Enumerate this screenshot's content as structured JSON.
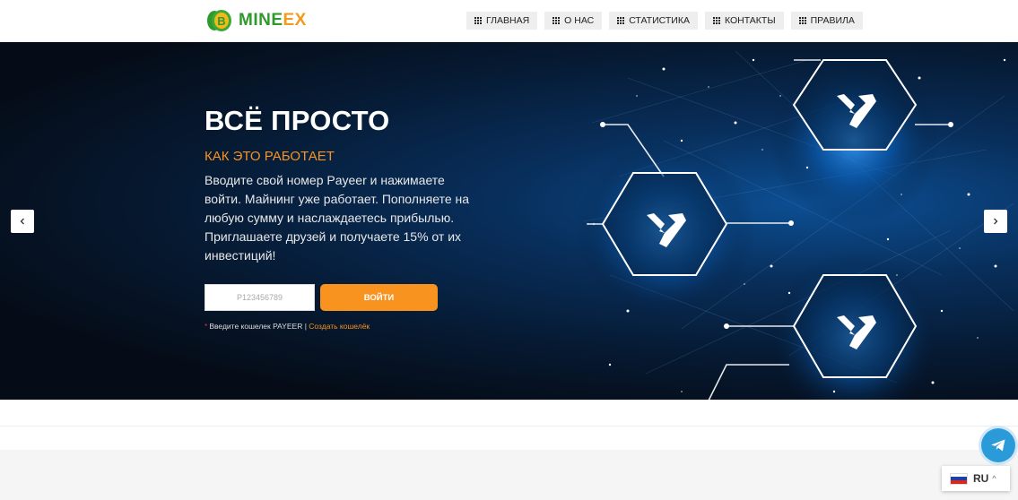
{
  "header": {
    "logo_prefix": "MINE",
    "logo_suffix": "EX",
    "nav": [
      {
        "label": "ГЛАВНАЯ",
        "icon": "grid-icon"
      },
      {
        "label": "О НАС",
        "icon": "grid-icon"
      },
      {
        "label": "СТАТИСТИКА",
        "icon": "grid-icon"
      },
      {
        "label": "КОНТАКТЫ",
        "icon": "grid-icon"
      },
      {
        "label": "ПРАВИЛА",
        "icon": "grid-icon"
      }
    ]
  },
  "hero": {
    "title": "ВСЁ ПРОСТО",
    "subtitle": "КАК ЭТО РАБОТАЕТ",
    "text": "Вводите свой номер Payeer и нажимаете войти. Майнинг уже работает. Пополняете на любую сумму и наслаждаетесь прибылью. Приглашаете друзей и получаете 15% от их инвестиций!",
    "wallet_placeholder": "P123456789",
    "login_label": "ВОЙТИ",
    "hint_star": "*",
    "hint_text": "Введите кошелек PAYEER | ",
    "hint_link": "Создать кошелёк"
  },
  "language": {
    "code": "RU",
    "flag_colors": [
      "#ffffff",
      "#1c3fa8",
      "#d52b1e"
    ]
  },
  "colors": {
    "accent": "#f7931e",
    "brand_green": "#2f9a2c",
    "telegram": "#2a9bd8"
  }
}
